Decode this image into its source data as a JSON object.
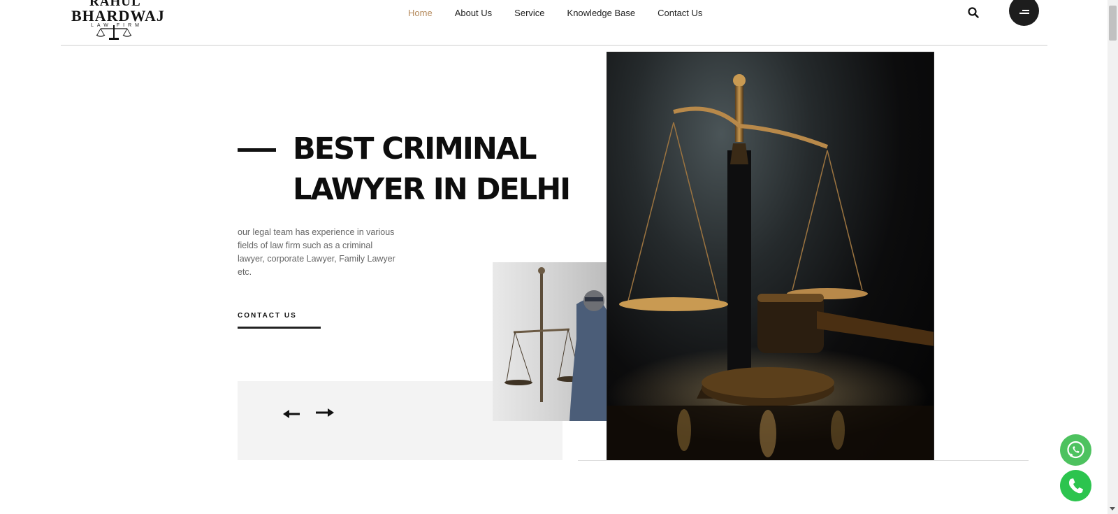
{
  "brand": {
    "logo_line1": "RAHUL",
    "logo_line2": "BHARDWAJ",
    "logo_line3": "LAW FIRM"
  },
  "nav": {
    "items": [
      {
        "label": "Home",
        "active": true
      },
      {
        "label": "About Us",
        "active": false
      },
      {
        "label": "Service",
        "active": false
      },
      {
        "label": "Knowledge Base",
        "active": false
      },
      {
        "label": "Contact Us",
        "active": false
      }
    ]
  },
  "hero": {
    "title_line1": "BEST CRIMINAL",
    "title_line2": "LAWYER IN DELHI",
    "description": "our legal team has experience in various fields of law firm such as a criminal lawyer, corporate Lawyer, Family Lawyer etc.",
    "cta_label": "CONTACT US"
  },
  "icons": {
    "search": "search-icon",
    "menu": "menu-icon",
    "prev": "arrow-left-icon",
    "next": "arrow-right-icon",
    "whatsapp": "whatsapp-icon",
    "phone": "phone-icon"
  },
  "colors": {
    "accent": "#b58a5c",
    "whatsapp": "#4dc25f",
    "call": "#2cc44e",
    "dark": "#1d1d1d"
  }
}
